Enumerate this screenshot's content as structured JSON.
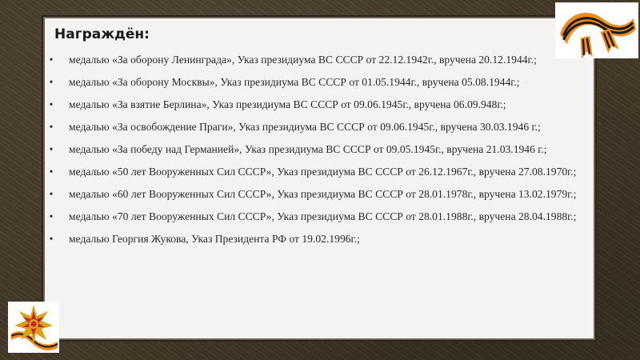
{
  "heading": "Награждён:",
  "awards": [
    "медалью «За оборону Ленинграда», Указ президиума ВС СССР от 22.12.1942г., вручена 20.12.1944г.;",
    "медалью «За оборону Москвы», Указ президиума ВС СССР от 01.05.1944г., вручена 05.08.1944г.;",
    "медалью «За взятие Берлина»,  Указ президиума ВС СССР от 09.06.1945г., вручена 06.09.948г.;",
    "медалью «За освобождение Праги», Указ президиума ВС СССР от 09.06.1945г., вручена 30.03.1946 г.;",
    "медалью «За победу над Германией»,  Указ президиума ВС СССР от 09.05.1945г., вручена 21.03.1946 г.;",
    "медалью «50 лет Вооруженных Сил СССР», Указ президиума ВС СССР от 26.12.1967г., вручена 27.08.1970г.;",
    "медалью «60 лет Вооруженных Сил СССР», Указ президиума ВС СССР от 28.01.1978г., вручена 13.02.1979г.;",
    "медалью «70 лет Вооруженных Сил СССР», Указ президиума ВС СССР от 28.01.1988г., вручена 28.04.1988г.;",
    "медалью Георгия Жукова, Указ Президента РФ от 19.02.1996г.;"
  ],
  "bullet": "•",
  "icons": [
    "st-george-ribbon-icon",
    "order-star-medal-icon"
  ],
  "colors": {
    "panel": "#f4f3f1",
    "frame": "#3d3425",
    "text": "#2a2a2a",
    "ribbon_orange": "#f08a1c",
    "ribbon_black": "#1b1b1b",
    "star_red": "#c62828",
    "gold": "#d9a21b"
  }
}
